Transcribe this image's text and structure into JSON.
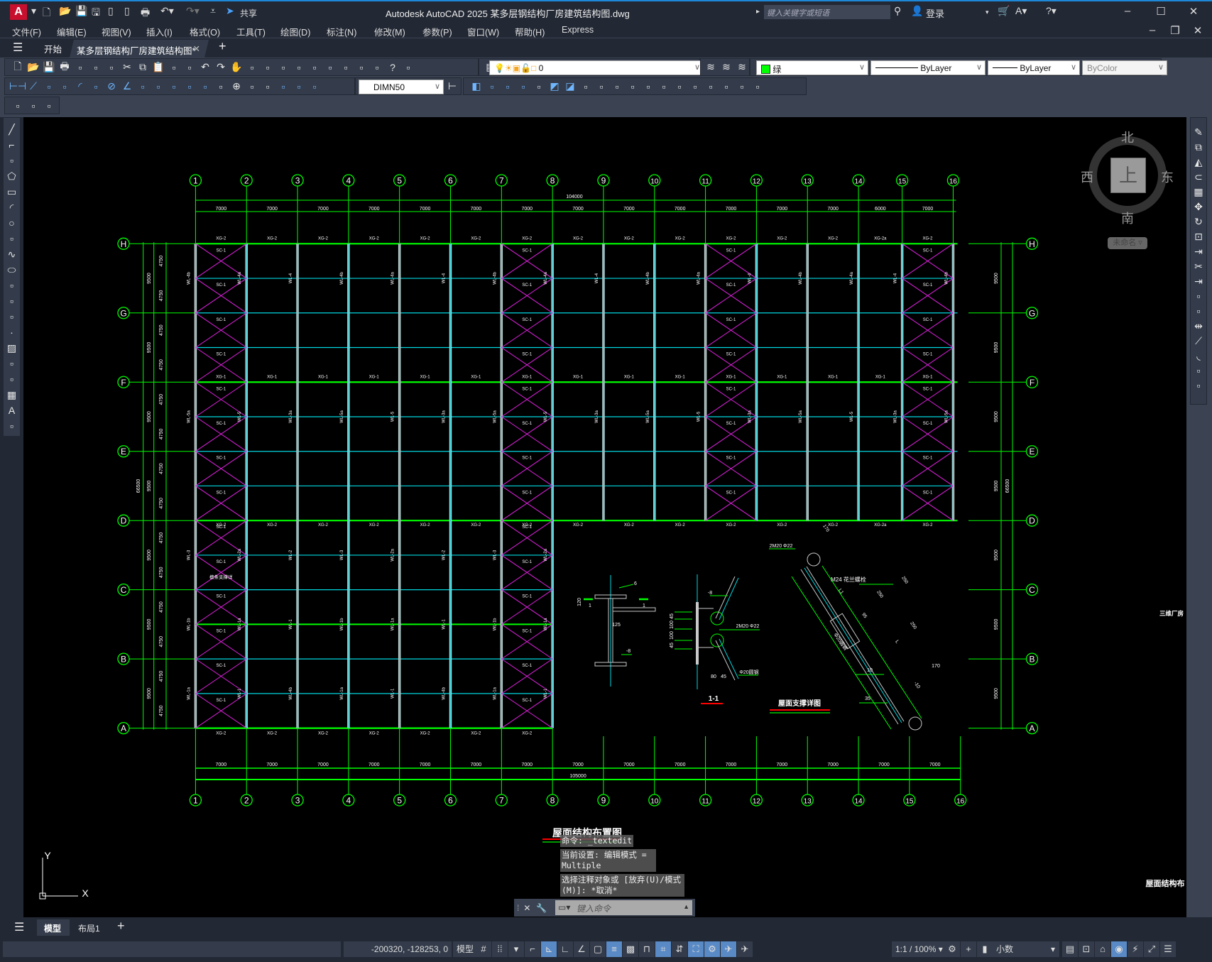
{
  "titlebar": {
    "app_title": "Autodesk AutoCAD 2025    某多层钢结构厂房建筑结构图.dwg",
    "share": "共享",
    "search_placeholder": "键入关键字或短语",
    "login": "登录"
  },
  "menu": [
    "文件(F)",
    "编辑(E)",
    "视图(V)",
    "插入(I)",
    "格式(O)",
    "工具(T)",
    "绘图(D)",
    "标注(N)",
    "修改(M)",
    "参数(P)",
    "窗口(W)",
    "帮助(H)",
    "Express"
  ],
  "tabs": {
    "start": "开始",
    "document": "某多层钢结构厂房建筑结构图*"
  },
  "properties": {
    "layer": "0",
    "color": "绿",
    "color_hex": "#00ff00",
    "linetype": "ByLayer",
    "lineweight": "ByLayer",
    "plotstyle": "ByColor",
    "dimstyle": "DIMN50"
  },
  "toolbar_rows": [
    [
      "new",
      "open",
      "save",
      "print",
      "print-preview",
      "publish",
      "dwf",
      "cut",
      "copy",
      "paste",
      "match-properties",
      "block-editor",
      "undo",
      "redo",
      "pan",
      "zoom-realtime",
      "zoom-window",
      "zoom-previous",
      "properties",
      "design-center",
      "tool-palettes",
      "sheet-set",
      "markup",
      "quickcalc",
      "help",
      "layer-properties"
    ],
    [
      "linear-dim",
      "aligned-dim",
      "arc-length-dim",
      "ordinate-dim",
      "radius-dim",
      "jogged-dim",
      "diameter-dim",
      "angular-dim",
      "quick-dim",
      "baseline-dim",
      "continue-dim",
      "dim-space",
      "dim-break",
      "tolerance",
      "center-mark",
      "inspect",
      "jogged-linear",
      "dim-edit",
      "dim-text-edit",
      "dim-update"
    ],
    [
      "text-edit",
      "text-check",
      "layer-state"
    ]
  ],
  "toolbar_row2b": [
    "box",
    "cylinder",
    "sphere",
    "extrude",
    "move-3d",
    "union",
    "subtract",
    "intersect",
    "slice",
    "thicken",
    "imprint",
    "separate",
    "shell",
    "check",
    "add-face",
    "sweep",
    "loft",
    "press-pull",
    "flatten"
  ],
  "draw_tools": [
    "line",
    "polyline",
    "multiline",
    "polygon",
    "rectangle",
    "arc",
    "circle",
    "revcloud",
    "spline",
    "ellipse",
    "ellipse-arc",
    "insert-block",
    "make-block",
    "point",
    "hatch",
    "gradient",
    "region",
    "table",
    "mtext",
    "add-selected"
  ],
  "modify_tools": [
    "erase",
    "copy",
    "mirror",
    "offset",
    "array",
    "move",
    "rotate",
    "scale",
    "stretch",
    "trim",
    "extend",
    "break-at-point",
    "break",
    "join",
    "chamfer",
    "fillet",
    "blend",
    "3d-solid-edit"
  ],
  "viewcube": {
    "north": "北",
    "south": "南",
    "west": "西",
    "east": "东",
    "top": "上",
    "ucs_menu": "未命名"
  },
  "drawing": {
    "top_axes": [
      "1",
      "2",
      "3",
      "4",
      "5",
      "6",
      "7",
      "8",
      "9",
      "10",
      "11",
      "12",
      "13",
      "14",
      "15",
      "16"
    ],
    "top_spans": [
      7000,
      7000,
      7000,
      7000,
      7000,
      7000,
      7000,
      7000,
      7000,
      7000,
      7000,
      7000,
      7000,
      6000,
      7000
    ],
    "top_total": "104000",
    "bottom_axes": [
      "1",
      "2",
      "3",
      "4",
      "5",
      "6",
      "7",
      "8",
      "9",
      "10",
      "11",
      "12",
      "13",
      "14",
      "15",
      "16"
    ],
    "bottom_spans": [
      7000,
      7000,
      7000,
      7000,
      7000,
      7000,
      7000,
      7000,
      7000,
      7000,
      7000,
      7000,
      7000,
      7000,
      7000
    ],
    "bottom_total": "105000",
    "rows": [
      "A",
      "B",
      "C",
      "D",
      "E",
      "F",
      "G",
      "H"
    ],
    "row_spans": [
      9500,
      9500,
      9500,
      9500,
      9500,
      9500,
      9500
    ],
    "half_span": "4750",
    "row_total": "66500",
    "beam_labels": {
      "H": "XG-2",
      "F": "XG-1",
      "D": "XG-2",
      "A": "XG-2",
      "D_mid": "XG-2a"
    },
    "brace_label": "SC-1",
    "column_labels": [
      "WL-4b",
      "WL-4a",
      "WL-4",
      "WL-5a",
      "WL-5",
      "WL-3a",
      "WL-3",
      "WL-2a",
      "WL-2",
      "WL-1b",
      "WL-1a",
      "WL-1"
    ],
    "special_note": "檩条支撑详",
    "details": {
      "section_title": "1-1",
      "brace_title": "屋面支撑详图",
      "labels": [
        "6",
        "1",
        "1",
        "120",
        "125",
        "-8",
        "-8",
        "45",
        "100",
        "100",
        "45",
        "2M20 Φ22",
        "Φ20圆钢",
        "80",
        "45",
        "2M20 Φ22",
        "M24 花兰螺栓",
        "170",
        "250",
        "250",
        "250",
        "95",
        "L1",
        "L",
        "Φ20圆钢",
        "10",
        "170",
        "-10",
        "35"
      ]
    },
    "plan_title": "屋面结构布置图",
    "side_label_1": "三维厂房",
    "side_label_2": "屋面结构布"
  },
  "command": {
    "history": [
      "命令: _textedit",
      "当前设置: 编辑模式 = Multiple",
      "选择注释对象或 [放弃(U)/模式(M)]: *取消*"
    ],
    "placeholder": "键入命令"
  },
  "ucs": {
    "x": "X",
    "y": "Y"
  },
  "layout_tabs": {
    "model": "模型",
    "layout1": "布局1"
  },
  "status": {
    "coords": "-200320, -128253, 0",
    "space": "模型",
    "scale": "1:1 / 100%",
    "units": "小数"
  }
}
